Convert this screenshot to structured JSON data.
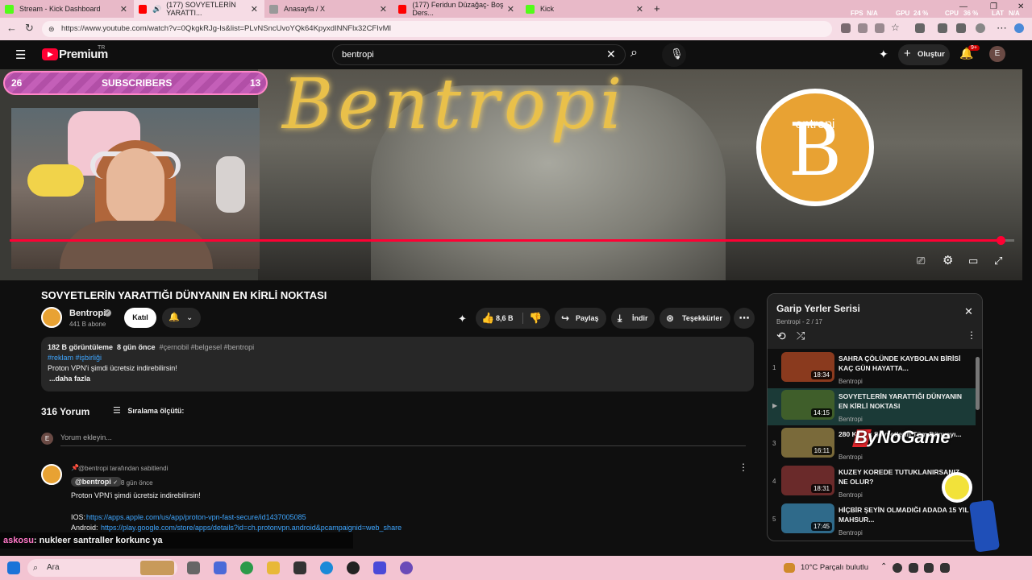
{
  "browser": {
    "tabs": [
      {
        "title": "Stream - Kick Dashboard",
        "fav": "#53fc18",
        "active": false
      },
      {
        "title": "(177) SOVYETLERİN YARATTI...",
        "fav": "#ff0000",
        "active": true
      },
      {
        "title": "Anasayfa / X",
        "fav": "#999999",
        "active": false
      },
      {
        "title": "(177) Feridun Düzağaç- Boş Ders...",
        "fav": "#ff0000",
        "active": false
      },
      {
        "title": "Kick",
        "fav": "#53fc18",
        "active": false
      }
    ],
    "new_tab_icon": "plus-icon",
    "stats": {
      "fps_label": "FPS",
      "fps": "N/A",
      "gpu_label": "GPU",
      "gpu": "24 %",
      "cpu_label": "CPU",
      "cpu": "36 %",
      "lat_label": "LAT",
      "lat": "N/A"
    },
    "url": "https://www.youtube.com/watch?v=0QkgkRJg-Is&list=PLvNSncUvoYQk64KpyxdINNFlx32CFIvMI"
  },
  "youtube": {
    "logo_text": "Premium",
    "logo_sup": "TR",
    "search_value": "bentropi",
    "create_label": "Oluştur",
    "notif_badge": "9+",
    "account_initial": "E"
  },
  "overlay": {
    "sub_left": "26",
    "sub_label": "SUBSCRIBERS",
    "sub_right": "13",
    "video_text": "Bentropi",
    "logo_letter": "B",
    "logo_word": "entropi",
    "progress": 0.986
  },
  "video": {
    "title": "SOVYETLERİN YARATTIĞI DÜNYANIN EN KİRLİ NOKTASI",
    "channel": "Bentropi",
    "subscribers": "441 B abone",
    "join_label": "Katıl",
    "likes": "8,6 B",
    "share_label": "Paylaş",
    "download_label": "İndir",
    "thanks_label": "Teşekkürler"
  },
  "description": {
    "views": "182 B görüntüleme",
    "date": "8 gün önce",
    "tags1": "#çernobil #belgesel #bentropi",
    "tags2": "#reklam",
    "tags3": "#işbirliği",
    "line": "Proton VPN'i şimdi ücretsiz indirebilirsin!",
    "more": "...daha fazla"
  },
  "comments": {
    "count": "316 Yorum",
    "sort_label": "Sıralama ölçütü:",
    "add_placeholder": "Yorum ekleyin...",
    "add_avatar": "E",
    "pinned": "@bentropi tarafından sabitlendi",
    "author": "@bentropi",
    "time": "8 gün önce",
    "text": "Proton VPN'i şimdi ücretsiz indirebilirsin!",
    "ios_label": "IOS:",
    "ios_link": "https://apps.apple.com/us/app/proton-vpn-fast-secure/id1437005085",
    "android_label": "Android:",
    "android_link": "https://play.google.com/store/apps/details?id=ch.protonvpn.android&pcampaignid=web_share"
  },
  "chat": {
    "user": "askosu",
    "message": ": nukleer santraller korkunc ya"
  },
  "playlist": {
    "title": "Garip Yerler Serisi",
    "sub": "Bentropi - 2 / 17",
    "items": [
      {
        "index": "1",
        "title": "SAHRA ÇÖLÜNDE KAYBOLAN BİRİSİ KAÇ GÜN HAYATTA...",
        "channel": "Bentropi",
        "duration": "18:34",
        "thumb": "#8a3a1e",
        "current": false
      },
      {
        "index": "▶",
        "title": "SOVYETLERİN YARATTIĞI DÜNYANIN EN KİRLİ NOKTASI",
        "channel": "Bentropi",
        "duration": "14:15",
        "thumb": "#3f5e2a",
        "current": true
      },
      {
        "index": "3",
        "title": "280 Kişilik Sovyetlerin Tüm Dünyayı...",
        "channel": "Bentropi",
        "duration": "16:11",
        "thumb": "#7a6a3a",
        "current": false
      },
      {
        "index": "4",
        "title": "KUZEY KOREDE TUTUKLANIRSANIZ NE OLUR?",
        "channel": "Bentropi",
        "duration": "18:31",
        "thumb": "#6a2a2a",
        "current": false
      },
      {
        "index": "5",
        "title": "HİÇBİR ŞEYİN OLMADIĞI ADADA 15 YIL MAHSUR...",
        "channel": "Bentropi",
        "duration": "17:45",
        "thumb": "#2f6a8a",
        "current": false
      }
    ]
  },
  "watermark": "ByNoGame",
  "taskbar": {
    "search": "Ara",
    "weather": "10°C  Parçalı bulutlu"
  }
}
